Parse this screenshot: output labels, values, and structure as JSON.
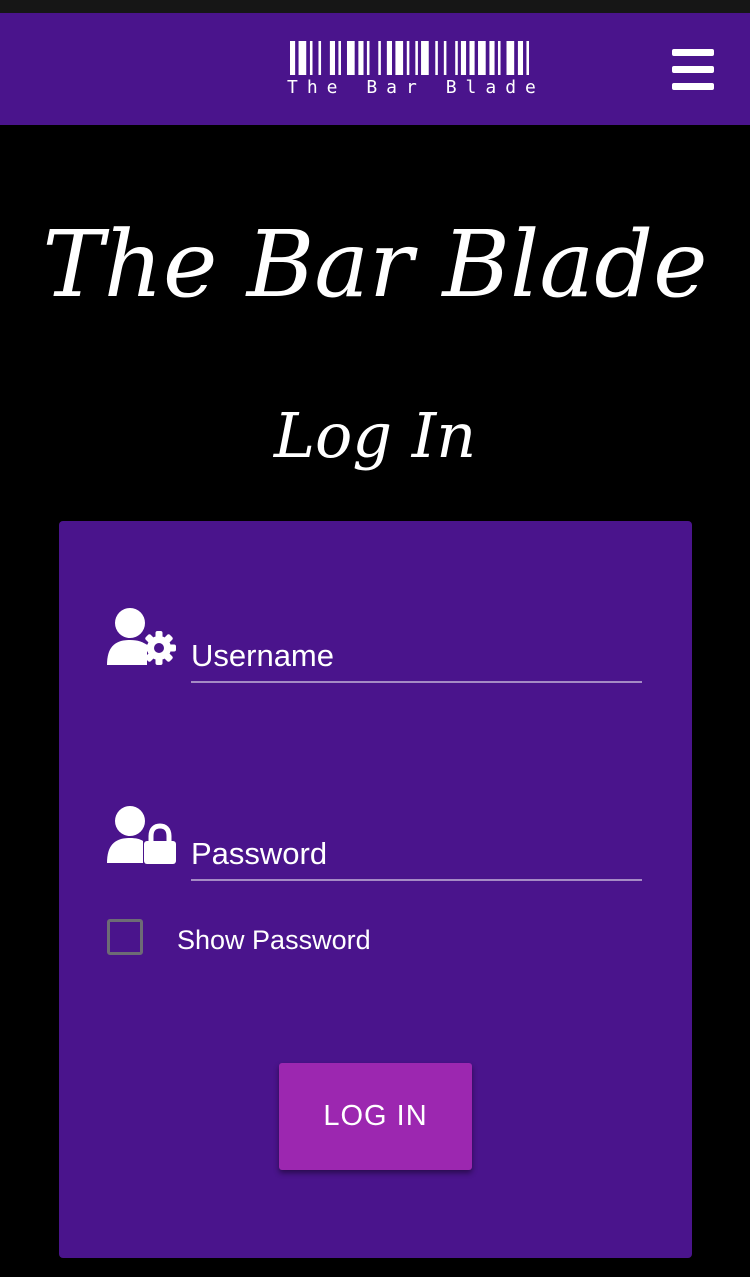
{
  "navbar": {
    "logo_text": "The Bar Blade",
    "menu_icon": "hamburger-menu-icon",
    "background_color": "#4a148c"
  },
  "hero": {
    "title": "The Bar Blade",
    "heading": "Log In"
  },
  "form": {
    "username": {
      "icon": "user-gear-icon",
      "placeholder": "Username",
      "value": ""
    },
    "password": {
      "icon": "user-lock-icon",
      "placeholder": "Password",
      "value": ""
    },
    "show_password_label": "Show Password",
    "show_password_checked": false,
    "submit_label": "LOG IN",
    "card_color": "#4a148c",
    "button_color": "#9c27b0"
  }
}
